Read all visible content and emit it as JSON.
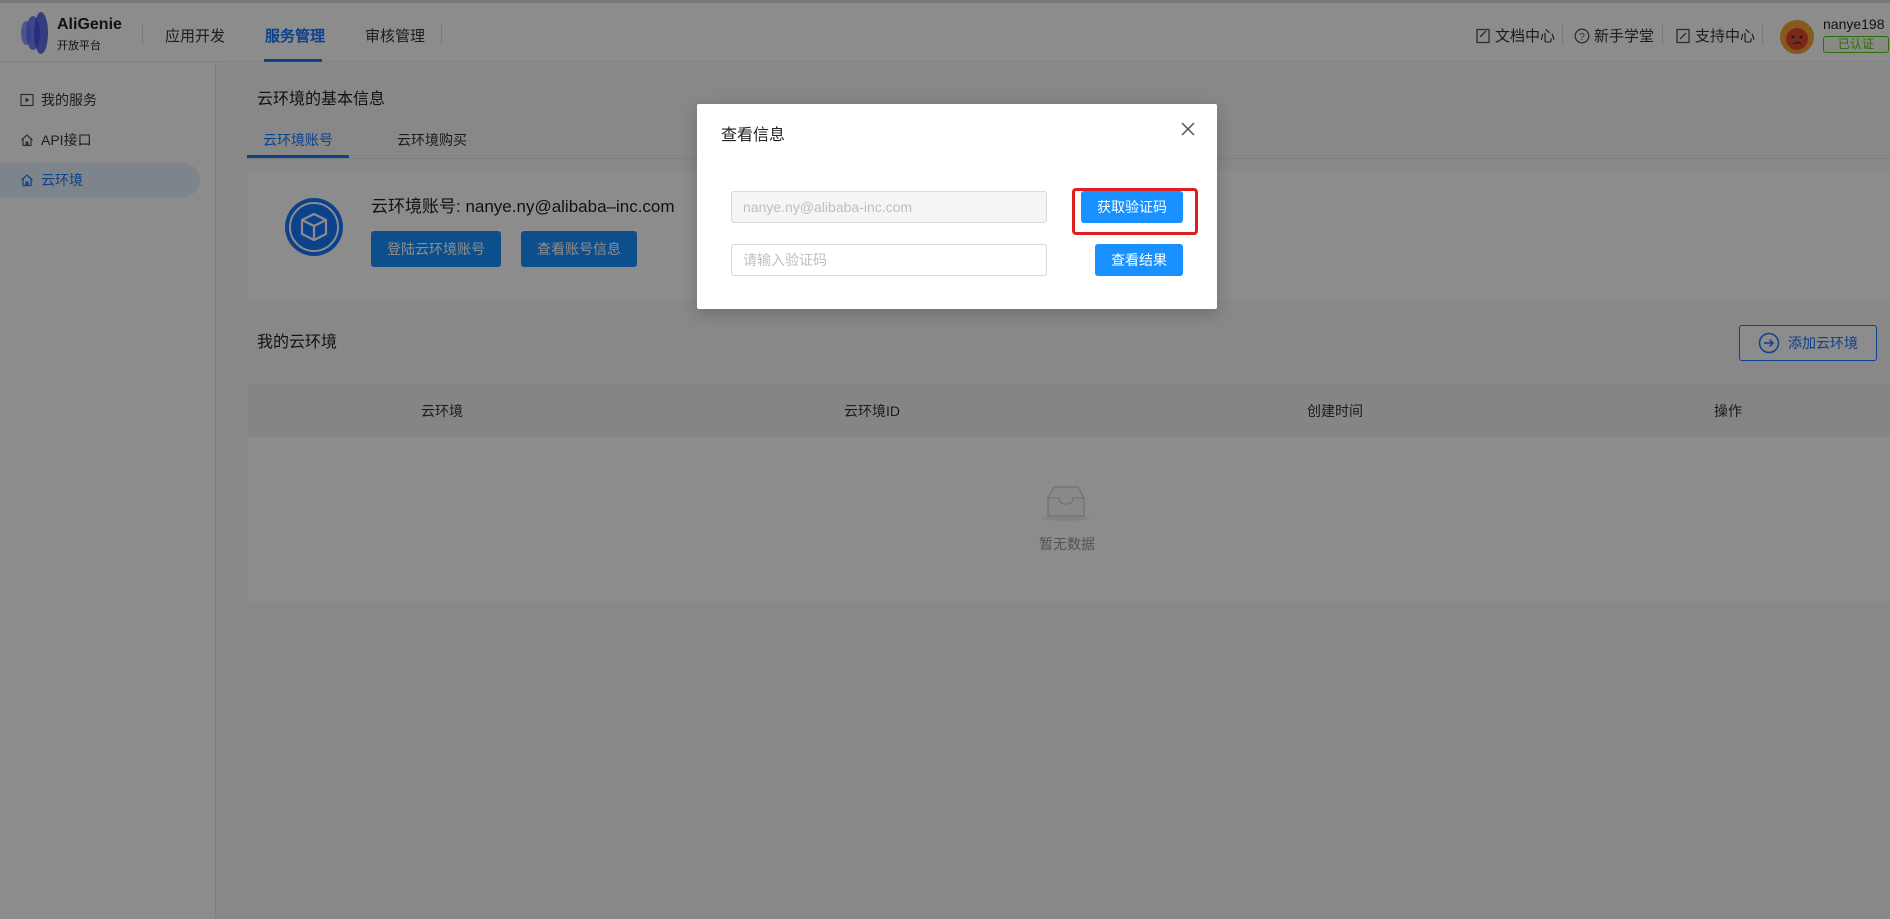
{
  "header": {
    "logo_title": "AliGenie",
    "logo_sub": "开放平台",
    "nav": [
      "应用开发",
      "服务管理",
      "审核管理"
    ],
    "links": [
      "文档中心",
      "新手学堂",
      "支持中心"
    ],
    "username": "nanye198",
    "verified": "已认证"
  },
  "sidebar": {
    "items": [
      "我的服务",
      "API接口",
      "云环境"
    ]
  },
  "main": {
    "basic_title": "云环境的基本信息",
    "tabs": [
      "云环境账号",
      "云环境购买"
    ],
    "account_text": "云环境账号: nanye.ny@alibaba–inc.com",
    "login_button": "登陆云环境账号",
    "view_button": "查看账号信息",
    "my_env_title": "我的云环境",
    "add_button": "添加云环境",
    "table_headers": [
      "云环境",
      "云环境ID",
      "创建时间",
      "操作"
    ],
    "empty_text": "暂无数据"
  },
  "modal": {
    "title": "查看信息",
    "email_placeholder": "nanye.ny@alibaba-inc.com",
    "code_placeholder": "请输入验证码",
    "get_code_button": "获取验证码",
    "result_button": "查看结果"
  },
  "colors": {
    "accent": "#1677ff",
    "highlight": "#e02020",
    "verified": "#52c41a"
  },
  "icons": [
    "logo-icon",
    "document-icon",
    "question-icon",
    "support-icon",
    "play-icon",
    "home-icon",
    "cube-icon",
    "arrow-circle-icon",
    "inbox-icon",
    "close-icon"
  ]
}
